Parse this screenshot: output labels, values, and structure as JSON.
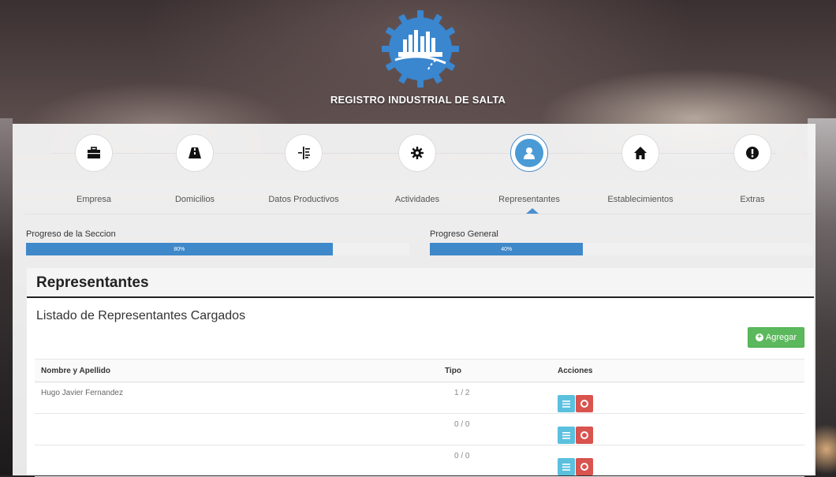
{
  "header": {
    "brand": "REGISTRO INDUSTRIAL DE SALTA"
  },
  "steps": [
    {
      "label": "Empresa",
      "icon": "briefcase-icon"
    },
    {
      "label": "Domicilios",
      "icon": "road-icon"
    },
    {
      "label": "Datos Productivos",
      "icon": "list-indent-icon"
    },
    {
      "label": "Actividades",
      "icon": "gear-icon"
    },
    {
      "label": "Representantes",
      "icon": "user-icon",
      "active": true
    },
    {
      "label": "Establecimientos",
      "icon": "home-icon"
    },
    {
      "label": "Extras",
      "icon": "exclamation-icon"
    }
  ],
  "progress": {
    "section": {
      "label": "Progreso de la Seccion",
      "value_text": "80%",
      "value": 0.8
    },
    "general": {
      "label": "Progreso General",
      "value_text": "40%",
      "value": 0.4
    }
  },
  "card": {
    "title": "Representantes",
    "list_title": "Listado de Representantes Cargados",
    "add_button": "Agregar",
    "columns": [
      "Nombre y Apellido",
      "Tipo",
      "Acciones"
    ],
    "rows": [
      {
        "nombre": "Hugo Javier Fernandez",
        "tipo": "1 / 2"
      },
      {
        "nombre": "",
        "tipo": "0 / 0"
      },
      {
        "nombre": "",
        "tipo": "0 / 0"
      }
    ]
  },
  "colors": {
    "primary": "#3f88c9",
    "success": "#5cb85c",
    "info": "#5bc0de",
    "danger": "#d9534f"
  }
}
